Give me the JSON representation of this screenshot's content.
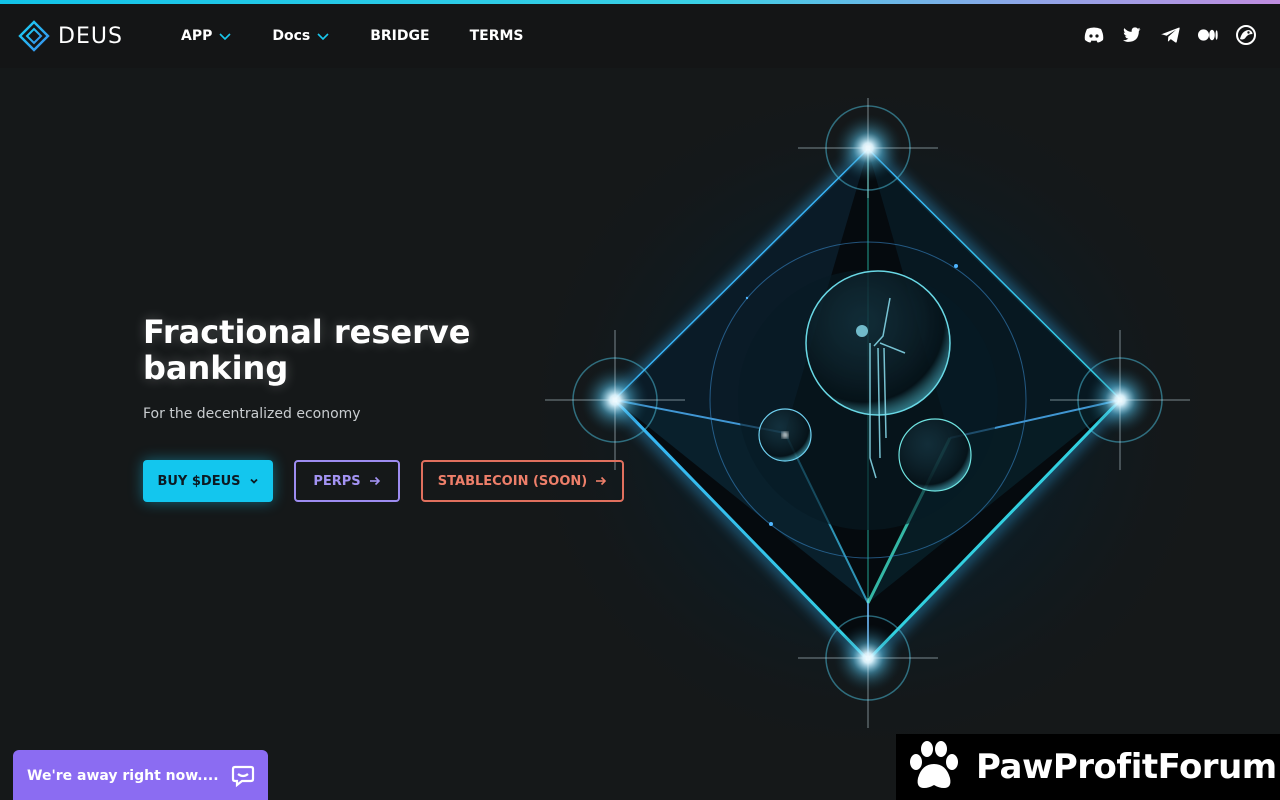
{
  "header": {
    "logo_text": "DEUS",
    "nav": [
      {
        "label": "APP",
        "has_dropdown": true
      },
      {
        "label": "Docs",
        "has_dropdown": true
      },
      {
        "label": "BRIDGE",
        "has_dropdown": false
      },
      {
        "label": "TERMS",
        "has_dropdown": false
      }
    ],
    "socials": [
      "discord-icon",
      "twitter-icon",
      "telegram-icon",
      "medium-icon",
      "coingecko-icon"
    ]
  },
  "hero": {
    "title": "Fractional reserve banking",
    "subtitle": "For the decentralized economy",
    "buttons": {
      "buy": "BUY $DEUS",
      "perps": "PERPS",
      "stablecoin": "STABLECOIN (SOON)"
    }
  },
  "chat": {
    "label": "We're away right now...."
  },
  "watermark": {
    "text": "PawProfitForum"
  },
  "colors": {
    "accent": "#13c6ee",
    "perps": "#9d8cf0",
    "stablecoin": "#e0705e",
    "chat": "#8b6cf2",
    "background": "#151819"
  }
}
